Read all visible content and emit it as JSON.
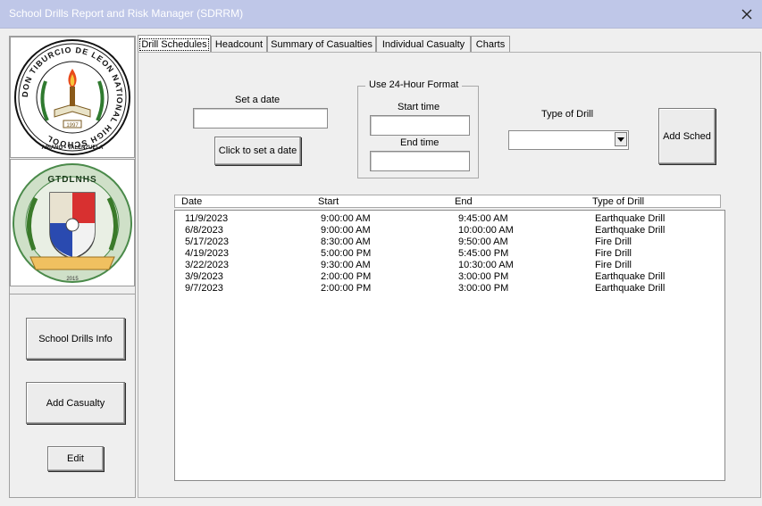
{
  "window": {
    "title": "School Drills Report and Risk Manager (SDRRM)"
  },
  "logos": {
    "school_seal_text": "DON TIBURCIO DE LEON NATIONAL HIGH SCHOOL",
    "school_seal_sub": "ARIANG • VALENZUELA",
    "school_seal_year": "1997",
    "club_logo_text": "GTDLNHS",
    "club_logo_year": "2015"
  },
  "sidebar": {
    "info_button": "School Drills Info",
    "casualty_button": "Add Casualty",
    "edit_button": "Edit"
  },
  "tabs": [
    {
      "label": "Drill Schedules"
    },
    {
      "label": "Headcount"
    },
    {
      "label": "Summary of Casualties"
    },
    {
      "label": "Individual Casualty"
    },
    {
      "label": "Charts"
    }
  ],
  "form": {
    "date_label": "Set a date",
    "date_value": "",
    "set_date_button": "Click to set a date",
    "time_group_label": "Use 24-Hour Format",
    "start_time_label": "Start time",
    "start_time_value": "",
    "end_time_label": "End time",
    "end_time_value": "",
    "drill_type_label": "Type of Drill",
    "drill_type_value": "",
    "add_button": "Add Sched"
  },
  "table": {
    "columns": [
      "Date",
      "Start",
      "End",
      "Type of Drill"
    ],
    "rows": [
      [
        "11/9/2023",
        "9:00:00 AM",
        "9:45:00 AM",
        "Earthquake Drill"
      ],
      [
        "6/8/2023",
        "9:00:00 AM",
        "10:00:00 AM",
        "Earthquake Drill"
      ],
      [
        "5/17/2023",
        "8:30:00 AM",
        "9:50:00 AM",
        "Fire Drill"
      ],
      [
        "4/19/2023",
        "5:00:00 PM",
        "5:45:00 PM",
        "Fire Drill"
      ],
      [
        "3/22/2023",
        "9:30:00 AM",
        "10:30:00 AM",
        "Fire Drill"
      ],
      [
        "3/9/2023",
        "2:00:00 PM",
        "3:00:00 PM",
        "Earthquake Drill"
      ],
      [
        "9/7/2023",
        "2:00:00 PM",
        "3:00:00 PM",
        "Earthquake Drill"
      ]
    ]
  },
  "icons": {
    "close": "close-icon",
    "dropdown": "chevron-down-icon"
  },
  "colors": {
    "titlebar": "#bfc7e8",
    "dialog": "#efefef",
    "list": "#ffffff"
  }
}
